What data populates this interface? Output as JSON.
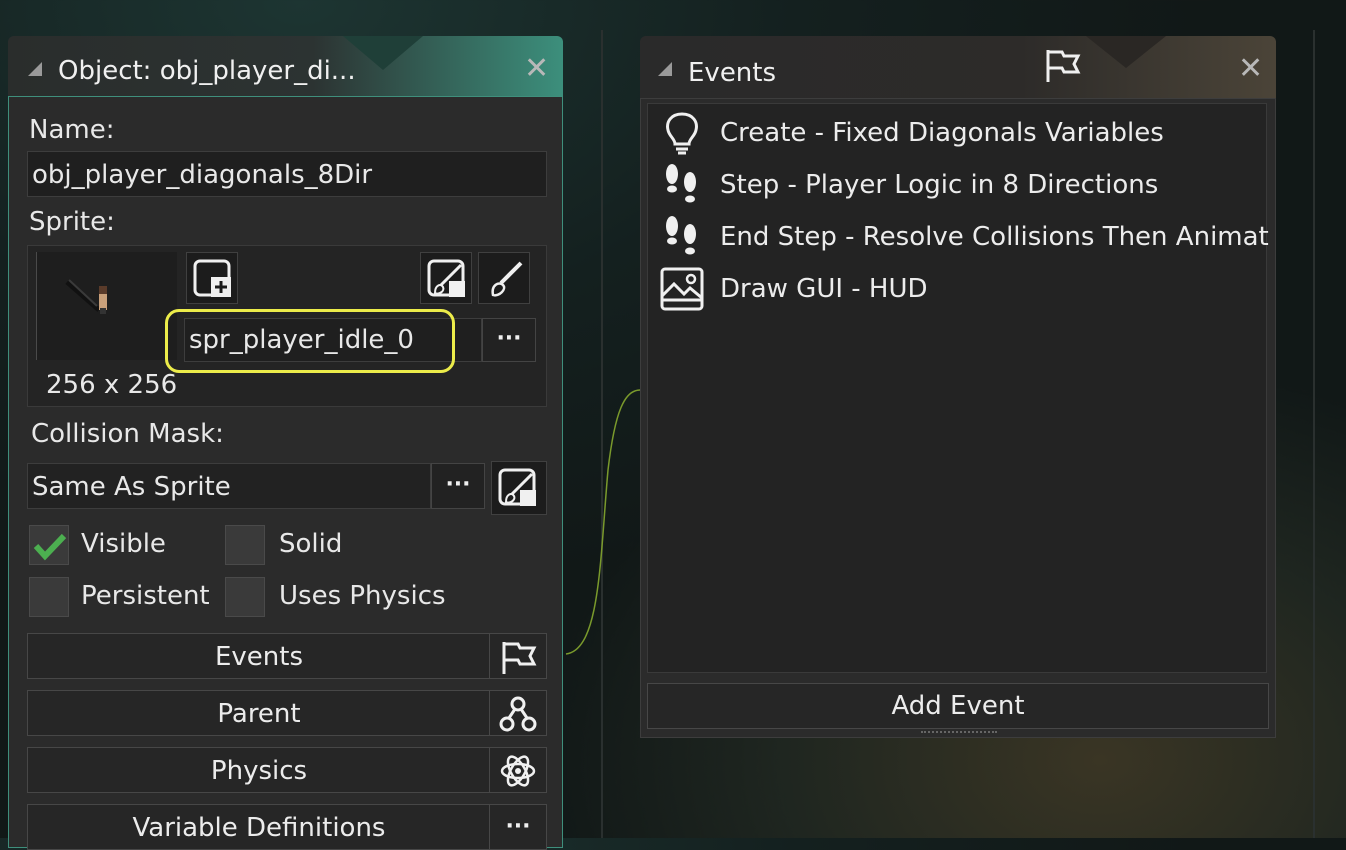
{
  "object_window": {
    "title": "Object: obj_player_di...",
    "close_glyph": "✕",
    "name_label": "Name:",
    "name_value": "obj_player_diagonals_8Dir",
    "sprite_label": "Sprite:",
    "sprite_value": "spr_player_idle_0",
    "sprite_size": "256 x 256",
    "sprite_more": "···",
    "collision_label": "Collision Mask:",
    "collision_value": "Same As Sprite",
    "collision_more": "···",
    "checkboxes": [
      {
        "label": "Visible",
        "checked": true
      },
      {
        "label": "Solid",
        "checked": false
      },
      {
        "label": "Persistent",
        "checked": false
      },
      {
        "label": "Uses Physics",
        "checked": false
      }
    ],
    "buttons": [
      {
        "label": "Events",
        "icon": "flag-icon"
      },
      {
        "label": "Parent",
        "icon": "hierarchy-icon"
      },
      {
        "label": "Physics",
        "icon": "atom-icon"
      },
      {
        "label": "Variable Definitions",
        "icon": "more-icon"
      }
    ],
    "variable_more": "···",
    "accent_color": "#3f8f7c"
  },
  "events_window": {
    "title": "Events",
    "close_glyph": "✕",
    "events": [
      {
        "label": "Create - Fixed Diagonals Variables",
        "icon": "lightbulb-icon"
      },
      {
        "label": "Step - Player Logic in 8 Directions",
        "icon": "footsteps-icon"
      },
      {
        "label": "End Step - Resolve Collisions Then Animat",
        "icon": "footsteps-icon"
      },
      {
        "label": "Draw GUI - HUD",
        "icon": "image-icon"
      }
    ],
    "add_event_label": "Add Event"
  },
  "highlight_color": "#ecec4a"
}
